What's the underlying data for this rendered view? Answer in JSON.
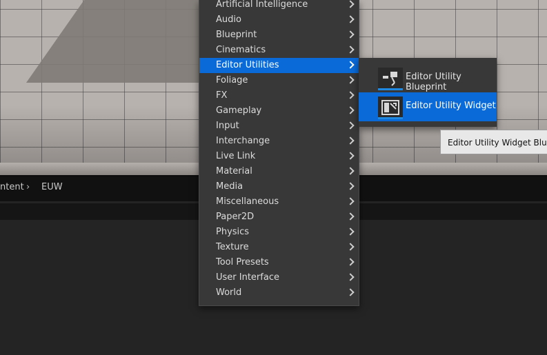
{
  "breadcrumb": {
    "items": [
      "ntent",
      "EUW"
    ]
  },
  "context_menu": {
    "items": [
      {
        "label": "Artificial Intelligence"
      },
      {
        "label": "Audio"
      },
      {
        "label": "Blueprint"
      },
      {
        "label": "Cinematics"
      },
      {
        "label": "Editor Utilities"
      },
      {
        "label": "Foliage"
      },
      {
        "label": "FX"
      },
      {
        "label": "Gameplay"
      },
      {
        "label": "Input"
      },
      {
        "label": "Interchange"
      },
      {
        "label": "Live Link"
      },
      {
        "label": "Material"
      },
      {
        "label": "Media"
      },
      {
        "label": "Miscellaneous"
      },
      {
        "label": "Paper2D"
      },
      {
        "label": "Physics"
      },
      {
        "label": "Texture"
      },
      {
        "label": "Tool Presets"
      },
      {
        "label": "User Interface"
      },
      {
        "label": "World"
      }
    ],
    "active_item": "Editor Utilities"
  },
  "submenu": {
    "items": [
      {
        "label": "Editor Utility Blueprint",
        "icon": "blueprint-icon"
      },
      {
        "label": "Editor Utility Widget",
        "icon": "widget-icon"
      }
    ],
    "active_item": "Editor Utility Widget"
  },
  "tooltip": {
    "text": "Editor Utility Widget Bluepr"
  },
  "colors": {
    "highlight": "#0a6ad8",
    "menu_bg": "#383838"
  }
}
